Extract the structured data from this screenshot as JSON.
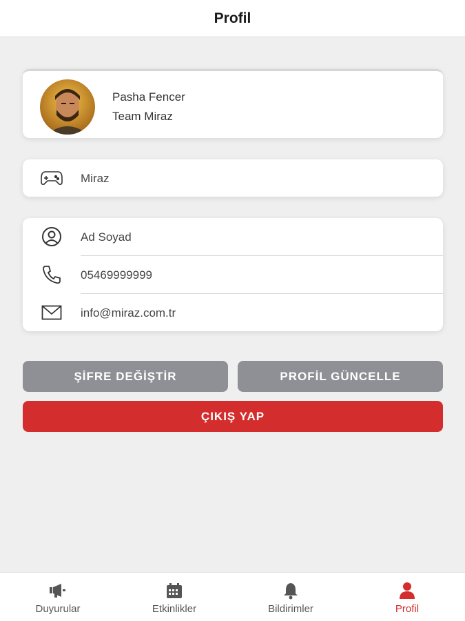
{
  "header": {
    "title": "Profil"
  },
  "profile": {
    "name": "Pasha Fencer",
    "team": "Team Miraz"
  },
  "team_field": {
    "value": "Miraz",
    "icon": "gamepad-icon"
  },
  "info": {
    "fullname": "Ad Soyad",
    "phone": "05469999999",
    "email": "info@miraz.com.tr"
  },
  "buttons": {
    "change_password": "ŞİFRE DEĞİŞTİR",
    "update_profile": "PROFİL GÜNCELLE",
    "logout": "ÇIKIŞ YAP"
  },
  "tabs": [
    {
      "label": "Duyurular",
      "icon": "megaphone-icon",
      "active": false
    },
    {
      "label": "Etkinlikler",
      "icon": "calendar-icon",
      "active": false
    },
    {
      "label": "Bildirimler",
      "icon": "bell-icon",
      "active": false
    },
    {
      "label": "Profil",
      "icon": "user-icon",
      "active": true
    }
  ],
  "colors": {
    "accent": "#d42d2d",
    "button_gray": "#8e9095",
    "background": "#efefef"
  }
}
